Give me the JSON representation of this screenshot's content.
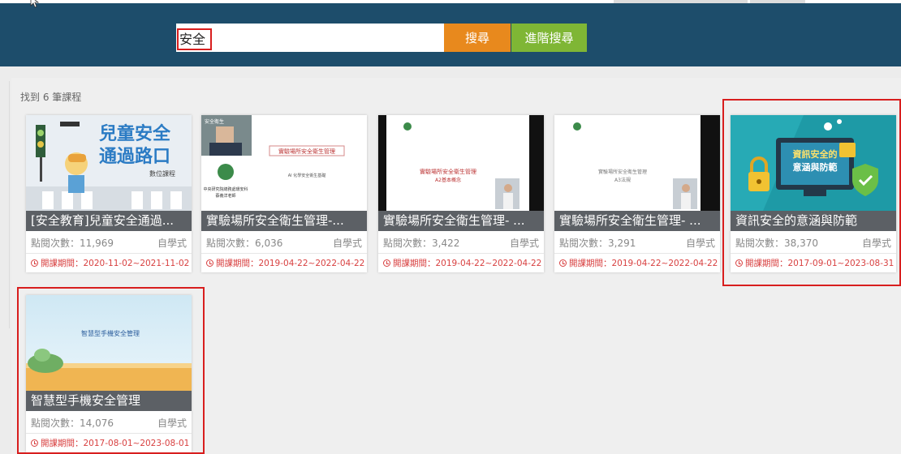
{
  "search": {
    "value": "安全",
    "search_label": "搜尋",
    "advanced_label": "進階搜尋"
  },
  "result_count": "找到 6 筆課程",
  "courses": [
    {
      "title": "[安全教育]兒童安全通過...",
      "views": "點閱次數：11,969",
      "type": "自學式",
      "period": "開課期間：2020-11-02~2021-11-02",
      "thumb_lines": [
        "兒童安全",
        "通過路口"
      ],
      "thumb_sub": "數位課程"
    },
    {
      "title": "實驗場所安全衛生管理-...",
      "views": "點閱次數：6,036",
      "type": "自學式",
      "period": "開課期間：2019-04-22~2022-04-22",
      "thumb_lines": [
        "安全衛生",
        "實驗場所安全衛生管理",
        "中央研究院總務處環安科",
        "蔡義洋老師",
        "AI 化學安全衛生基礎"
      ]
    },
    {
      "title": "實驗場所安全衛生管理- ...",
      "views": "點閱次數：3,422",
      "type": "自學式",
      "period": "開課期間：2019-04-22~2022-04-22",
      "thumb_lines": [
        "實驗場所安全衛生管理",
        "A2基本概念"
      ]
    },
    {
      "title": "實驗場所安全衛生管理- ...",
      "views": "點閱次數：3,291",
      "type": "自學式",
      "period": "開課期間：2019-04-22~2022-04-22",
      "thumb_lines": [
        "實驗場所安全衛生管理",
        "A3法規"
      ]
    },
    {
      "title": "資訊安全的意涵與防範",
      "views": "點閱次數：38,370",
      "type": "自學式",
      "period": "開課期間：2017-09-01~2023-08-31",
      "thumb_lines": [
        "資訊安全的",
        "意涵與防範"
      ]
    },
    {
      "title": "智慧型手機安全管理",
      "views": "點閱次數：14,076",
      "type": "自學式",
      "period": "開課期間：2017-08-01~2023-08-01",
      "thumb_lines": [
        "智慧型手機安全管理"
      ]
    }
  ],
  "colors": {
    "header": "#1d4d6b",
    "search_button": "#e8891d",
    "advanced_button": "#7fb635",
    "highlight": "#d81e1e"
  }
}
